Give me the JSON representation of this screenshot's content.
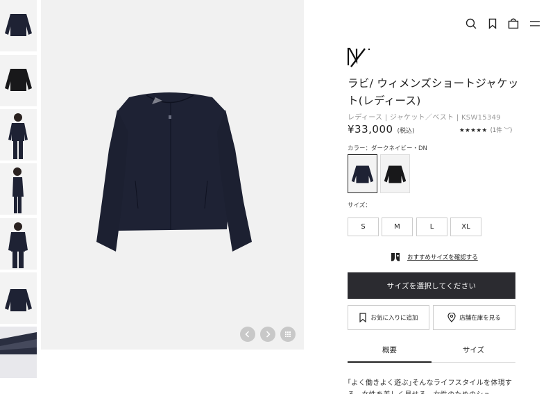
{
  "header": {
    "icons": [
      "search-icon",
      "bookmark-icon",
      "bag-icon",
      "menu-icon"
    ]
  },
  "gallery": {
    "thumbnails": [
      "thumbnail-navy-jacket",
      "thumbnail-black-jacket",
      "thumbnail-model-front",
      "thumbnail-model-side",
      "thumbnail-model-back",
      "thumbnail-navy-jacket-flat",
      "thumbnail-detail"
    ],
    "controls": [
      "prev-arrow-icon",
      "next-arrow-icon",
      "grid-icon"
    ]
  },
  "product": {
    "title": "ラビ/ ウィメンズショートジャケット(レディース)",
    "meta": "レディース | ジャケット／ベスト | KSW15349",
    "price": "¥33,000",
    "tax_note": "(税込)",
    "stars": "★★★★★",
    "review_count": "(1件 ﹀)",
    "color_label": "カラー：ダークネイビー・DN",
    "size_label": "サイズ：",
    "sizes": [
      "S",
      "M",
      "L",
      "XL"
    ],
    "size_guide": "おすすめサイズを確認する",
    "cta": "サイズを選択してください",
    "favorite": "お気に入りに追加",
    "store_stock": "店舗在庫を見る"
  },
  "tabs": [
    "概要",
    "サイズ"
  ],
  "description": "｢よく働きよく遊ぶ｣そんなライフスタイルを体現する、女性を美しく見せる、女性のためのシュ",
  "colors": {
    "navy": "#1e2234",
    "black": "#18181a",
    "cta_bg": "#2b2b30",
    "image_bg": "#f1f1f1"
  }
}
